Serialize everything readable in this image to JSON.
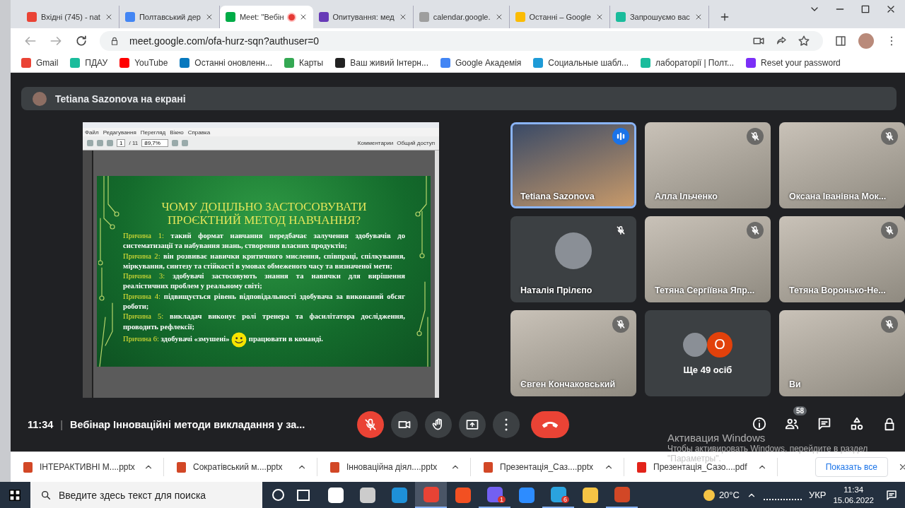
{
  "tabs": [
    {
      "title": "Вхідні (745) - nat",
      "color": "#ea4335",
      "selected": false,
      "recording": false
    },
    {
      "title": "Полтавський дер",
      "color": "#4285f4",
      "selected": false,
      "recording": false
    },
    {
      "title": "Meet: \"Вебін",
      "color": "#00ac47",
      "selected": true,
      "recording": true
    },
    {
      "title": "Опитування: мед",
      "color": "#673ab7",
      "selected": false,
      "recording": false
    },
    {
      "title": "calendar.google.",
      "color": "#9e9e9e",
      "selected": false,
      "recording": false
    },
    {
      "title": "Останні – Google",
      "color": "#fbbc04",
      "selected": false,
      "recording": false
    },
    {
      "title": "Запрошуємо вас",
      "color": "#1abc9c",
      "selected": false,
      "recording": false
    }
  ],
  "address": {
    "url": "meet.google.com/ofa-hurz-sqn?authuser=0"
  },
  "bookmarks": [
    {
      "label": "Gmail",
      "color": "#ea4335"
    },
    {
      "label": "ПДАУ",
      "color": "#1abc9c"
    },
    {
      "label": "YouTube",
      "color": "#ff0000"
    },
    {
      "label": "Останні оновленн...",
      "color": "#0678be"
    },
    {
      "label": "Карты",
      "color": "#34a853"
    },
    {
      "label": "Ваш живий Інтерн...",
      "color": "#222222"
    },
    {
      "label": "Google Академія",
      "color": "#4285f4"
    },
    {
      "label": "Социальные шабл...",
      "color": "#1e9bd7"
    },
    {
      "label": "лабораторії | Полт...",
      "color": "#1abc9c"
    },
    {
      "label": "Reset your password",
      "color": "#7b2ff7"
    }
  ],
  "presenter_banner": {
    "text": "Tetiana Sazonova на екрані"
  },
  "viewer": {
    "menu": [
      "Файл",
      "Редагування",
      "Перегляд",
      "Вікно",
      "Справка"
    ],
    "page": "1",
    "pages": "/ 11",
    "zoom": "89,7%",
    "toolbar_right": [
      "Комментарии",
      "Общий доступ"
    ]
  },
  "slide": {
    "title": "ЧОМУ ДОЦІЛЬНО ЗАСТОСОВУВАТИ ПРОЄКТНИЙ МЕТОД НАВЧАННЯ?",
    "reasons": [
      {
        "label": "Причина 1:",
        "text": "такий формат навчання передбачає залучення здобувачів до систематизації та набування знань, створення власних продуктів;"
      },
      {
        "label": "Причина 2:",
        "text": "він розвиває навички критичного мислення, співпраці, спілкування, міркування, синтезу та стійкості в умовах обмеженого часу та визначеної мети;"
      },
      {
        "label": "Причина 3:",
        "text": "здобувачі застосовують знання та навички для вирішення реалістичних проблем у реальному світі;"
      },
      {
        "label": "Причина 4:",
        "text": "підвищується рівень відповідальності здобувача за виконаний обсяг роботи;"
      },
      {
        "label": "Причина 5:",
        "text": "викладач виконує ролі тренера та фасилітатора дослідження, проводить рефлексії;"
      },
      {
        "label": "Причина 6:",
        "text": "здобувачі «змушені»",
        "text_after": "працювати в команді."
      }
    ]
  },
  "participants": [
    {
      "kind": "video",
      "name": "Tetiana Sazonova",
      "speaking": true,
      "muted": false
    },
    {
      "kind": "video",
      "name": "Алла Ільченко",
      "speaking": false,
      "muted": true
    },
    {
      "kind": "video",
      "name": "Оксана Іванівна Мок...",
      "speaking": false,
      "muted": true
    },
    {
      "kind": "avatar",
      "name": "Наталія Прілєпо",
      "speaking": false,
      "muted": true
    },
    {
      "kind": "video",
      "name": "Тетяна Сергіївна Япр...",
      "speaking": false,
      "muted": true
    },
    {
      "kind": "video",
      "name": "Тетяна Воронько-Не...",
      "speaking": false,
      "muted": true
    },
    {
      "kind": "video",
      "name": "Євген Кончаковський",
      "speaking": false,
      "muted": true
    },
    {
      "kind": "more",
      "name": "Ще 49 осіб",
      "initial": "О",
      "speaking": false,
      "muted": false
    },
    {
      "kind": "video",
      "name": "Ви",
      "speaking": false,
      "muted": true
    }
  ],
  "meeting": {
    "time": "11:34",
    "separator": "|",
    "title": "Вебінар Інноваційні методи викладання у за..."
  },
  "controls": [
    {
      "kind": "mic",
      "on": false
    },
    {
      "kind": "camera",
      "on": true
    },
    {
      "kind": "hand"
    },
    {
      "kind": "present"
    },
    {
      "kind": "more"
    },
    {
      "kind": "end"
    }
  ],
  "side_controls": [
    {
      "kind": "info"
    },
    {
      "kind": "people",
      "badge": "58"
    },
    {
      "kind": "chat"
    },
    {
      "kind": "activities"
    },
    {
      "kind": "lock"
    }
  ],
  "windows_notice": {
    "title": "Активация Windows",
    "text": "Чтобы активировать Windows, перейдите в раздел \"Параметры\"."
  },
  "downloads": [
    {
      "name": "ІНТЕРАКТИВНІ М....pptx",
      "kind": "pptx"
    },
    {
      "name": "Сократівський м....pptx",
      "kind": "pptx"
    },
    {
      "name": "Інноваційна діял....pptx",
      "kind": "pptx"
    },
    {
      "name": "Презентація_Саз....pptx",
      "kind": "pptx"
    },
    {
      "name": "Презентація_Сазо....pdf",
      "kind": "pdf"
    }
  ],
  "show_all": "Показать все",
  "taskbar": {
    "search_placeholder": "Введите здесь текст для поиска",
    "apps": [
      {
        "color": "#ffffff",
        "selected": false,
        "running": false
      },
      {
        "color": "#cccccc",
        "selected": false,
        "running": false
      },
      {
        "color": "#1e90d8",
        "selected": false,
        "running": false
      },
      {
        "color": "#e84335",
        "selected": true,
        "running": true
      },
      {
        "color": "#f25022",
        "selected": false,
        "running": false
      },
      {
        "color": "#7360f2",
        "selected": false,
        "running": true,
        "badge": "1"
      },
      {
        "color": "#2d8cff",
        "selected": false,
        "running": false
      },
      {
        "color": "#2aa3df",
        "selected": false,
        "running": true,
        "badge": "6"
      },
      {
        "color": "#f6c445",
        "selected": false,
        "running": false
      },
      {
        "color": "#d24726",
        "selected": false,
        "running": true
      }
    ],
    "temperature": "20°C",
    "language": "УКР",
    "time": "11:34",
    "date": "15.06.2022"
  }
}
